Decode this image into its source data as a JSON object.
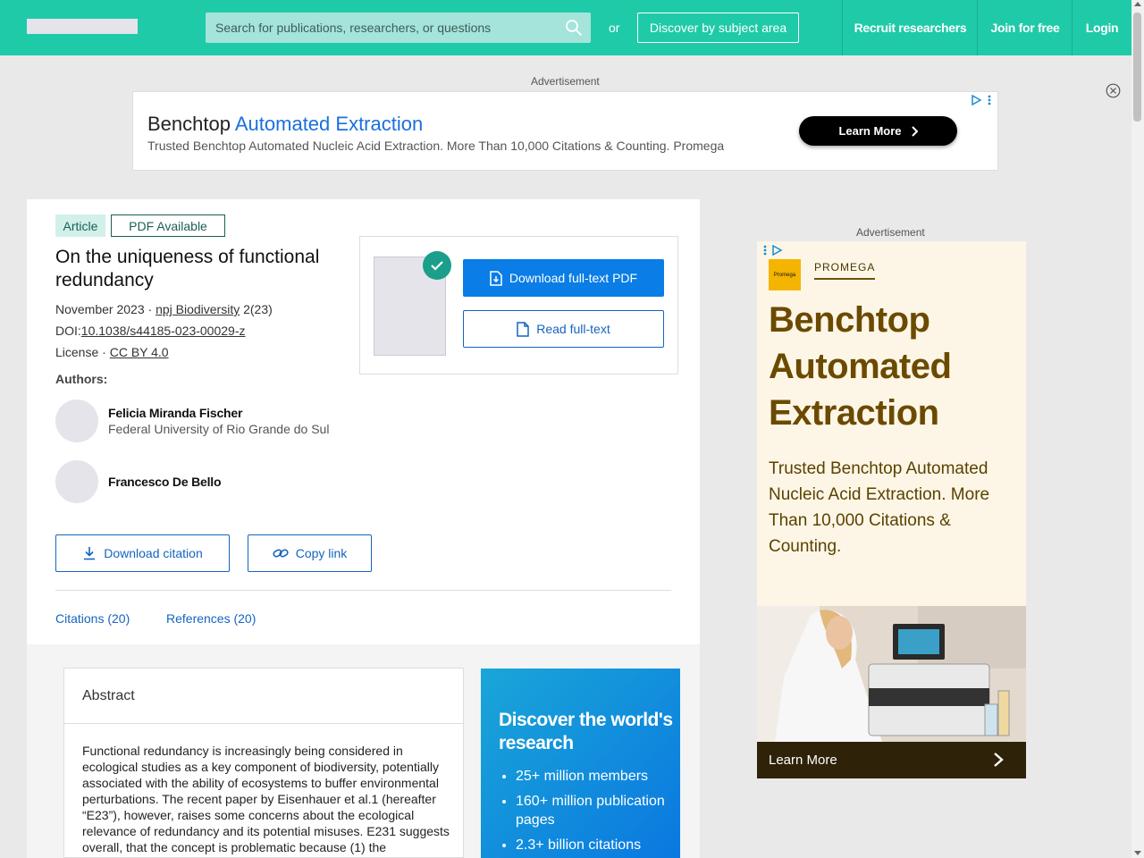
{
  "header": {
    "search_placeholder": "Search for publications, researchers, or questions",
    "or_text": "or",
    "discover_label": "Discover by subject area",
    "nav": [
      {
        "label": "Recruit researchers"
      },
      {
        "label": "Join for free"
      },
      {
        "label": "Login"
      }
    ]
  },
  "ads": {
    "label": "Advertisement",
    "top": {
      "headline_plain": "Benchtop ",
      "headline_accent": "Automated Extraction",
      "subtext": "Trusted Benchtop Automated Nucleic Acid Extraction. More Than 10,000 Citations & Counting. Promega",
      "cta": "Learn More"
    },
    "side": {
      "logo_text": "Promega",
      "brand": "PROMEGA",
      "headline": "Benchtop Automated Extraction",
      "body": "Trusted Benchtop Automated Nucleic Acid Extraction. More Than 10,000 Citations & Counting.",
      "cta": "Learn More"
    }
  },
  "article": {
    "badge_type": "Article",
    "badge_pdf": "PDF Available",
    "title": "On the uniqueness of functional redundancy",
    "date_prefix": "November 2023 · ",
    "journal": "npj Biodiversity",
    "issue": " 2(23)",
    "doi_prefix": "DOI:",
    "doi": "10.1038/s44185-023-00029-z",
    "license_prefix": "License · ",
    "license": "CC BY 4.0",
    "authors_label": "Authors:",
    "authors": [
      {
        "name": "Felicia Miranda Fischer",
        "affiliation": "Federal University of Rio Grande do Sul"
      },
      {
        "name": "Francesco De Bello",
        "affiliation": ""
      }
    ],
    "download_citation": "Download citation",
    "copy_link": "Copy link",
    "tabs": [
      {
        "label": "Citations (20)"
      },
      {
        "label": "References (20)"
      }
    ],
    "download_pdf": "Download full-text PDF",
    "read_fulltext": "Read full-text"
  },
  "abstract": {
    "heading": "Abstract",
    "text": "Functional redundancy is increasingly being considered in ecological studies as a key component of biodiversity, potentially associated with the ability of ecosystems to buffer environmental perturbations. The recent paper by Eisenhauer et al.1 (hereafter “E23”), however, raises some concerns about the ecological relevance of redundancy and its potential misuses. E231 suggests overall, that the concept is problematic because (1) the"
  },
  "promo": {
    "heading": "Discover the world's research",
    "bullets": [
      "25+ million members",
      "160+ million publication pages",
      "2.3+ billion citations"
    ]
  },
  "colors": {
    "brand_teal": "#1fcaa8",
    "link_blue": "#1564c0",
    "primary_button": "#0a7de6"
  }
}
